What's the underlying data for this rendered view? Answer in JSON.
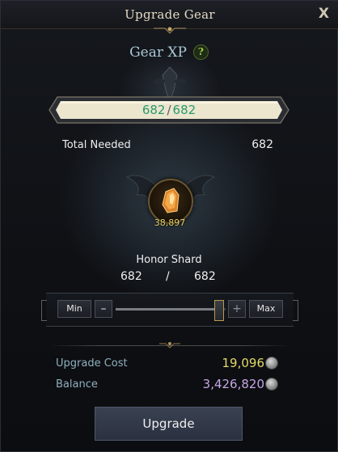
{
  "window": {
    "title": "Upgrade Gear",
    "close_label": "X"
  },
  "gear_xp": {
    "title": "Gear XP",
    "help_label": "?",
    "current": "682",
    "max": "682",
    "separator": "/"
  },
  "total_needed": {
    "label": "Total Needed",
    "value": "682"
  },
  "material": {
    "icon": "honor-shard-icon",
    "owned": "38,897",
    "name": "Honor Shard",
    "selected": "682",
    "separator": "/",
    "needed": "682"
  },
  "quantity_slider": {
    "min_label": "Min",
    "minus_label": "–",
    "plus_label": "+",
    "max_label": "Max",
    "level": 0.94
  },
  "cost": {
    "upgrade_cost_label": "Upgrade Cost",
    "upgrade_cost_value": "19,096",
    "balance_label": "Balance",
    "balance_value": "3,426,820",
    "currency_icon": "silver-coin-icon"
  },
  "actions": {
    "upgrade_label": "Upgrade"
  },
  "colors": {
    "xp_text": "#2a9a6a",
    "cost_value": "#e3da6a",
    "balance_value": "#c4a6e6",
    "material_count": "#e8d36a"
  }
}
